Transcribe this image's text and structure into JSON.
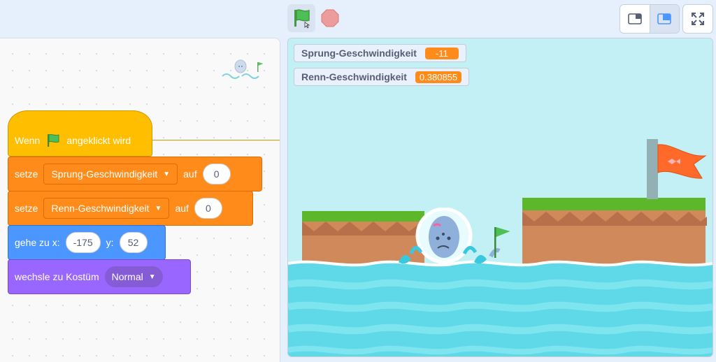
{
  "toolbar": {
    "green_flag_icon": "green-flag-icon",
    "stop_icon": "stop-icon",
    "colors": {
      "flag": "#4cbf56",
      "stop": "#ec9c9c"
    }
  },
  "monitors": [
    {
      "label": "Sprung-Geschwindigkeit",
      "value": "-11"
    },
    {
      "label": "Renn-Geschwindigkeit",
      "value": "0.380855"
    }
  ],
  "blocks": {
    "hat": {
      "before": "Wenn",
      "after": "angeklickt wird"
    },
    "set1": {
      "verb": "setze",
      "variable": "Sprung-Geschwindigkeit",
      "to": "auf",
      "value": "0"
    },
    "set2": {
      "verb": "setze",
      "variable": "Renn-Geschwindigkeit",
      "to": "auf",
      "value": "0"
    },
    "goto": {
      "label_x": "gehe zu x:",
      "x": "-175",
      "label_y": "y:",
      "y": "52"
    },
    "costume": {
      "label": "wechsle zu Kostüm",
      "value": "Normal"
    }
  },
  "colors": {
    "events": "#ffbf00",
    "variables": "#ff8c1a",
    "motion": "#4c97ff",
    "looks": "#9966ff",
    "water": "#5fd8e8",
    "grass": "#5cb82a",
    "dirt": "#d08a5c"
  }
}
